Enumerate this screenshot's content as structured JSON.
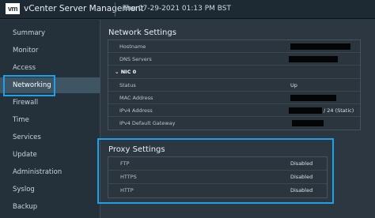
{
  "header": {
    "logo_text": "vm",
    "app_title": "vCenter Server Management",
    "datetime": "Thu 07-29-2021 01:13 PM BST"
  },
  "sidebar": {
    "items": [
      {
        "label": "Summary"
      },
      {
        "label": "Monitor"
      },
      {
        "label": "Access"
      },
      {
        "label": "Networking",
        "active": true
      },
      {
        "label": "Firewall"
      },
      {
        "label": "Time"
      },
      {
        "label": "Services"
      },
      {
        "label": "Update"
      },
      {
        "label": "Administration"
      },
      {
        "label": "Syslog"
      },
      {
        "label": "Backup"
      }
    ]
  },
  "network": {
    "title": "Network Settings",
    "hostname_label": "Hostname",
    "dns_label": "DNS Servers",
    "nic_label": "NIC 0",
    "status_label": "Status",
    "status_value": "Up",
    "mac_label": "MAC Address",
    "ipv4_label": "IPv4 Address",
    "ipv4_suffix": "/ 24 (Static)",
    "gateway_label": "IPv4 Default Gateway"
  },
  "proxy": {
    "title": "Proxy Settings",
    "rows": [
      {
        "label": "FTP",
        "value": "Disabled"
      },
      {
        "label": "HTTPS",
        "value": "Disabled"
      },
      {
        "label": "HTTP",
        "value": "Disabled"
      }
    ]
  },
  "colors": {
    "highlight": "#1aa3ea",
    "sidebar_active": "#3f5563",
    "background": "#2c3741",
    "redaction": "#050505"
  }
}
